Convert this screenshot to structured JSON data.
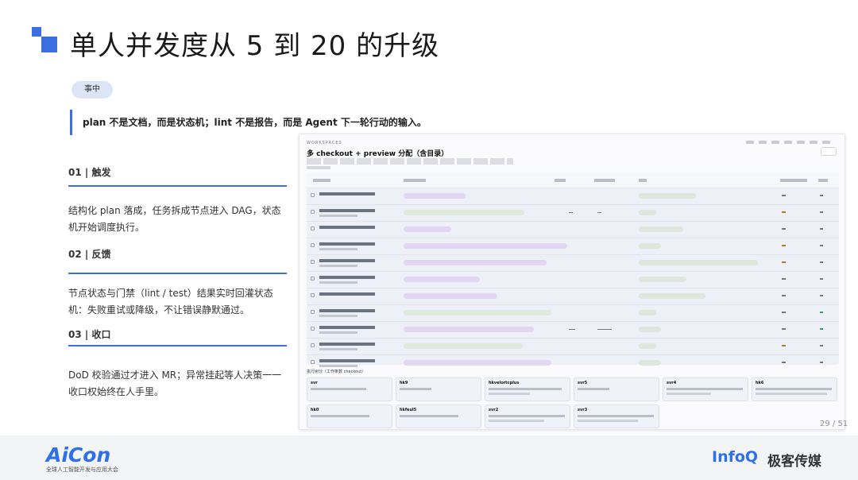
{
  "slide": {
    "title": "单人并发度从 5 到 20 的升级",
    "stage_tag": "事中",
    "quote": "plan 不是文档，而是状态机；lint 不是报告，而是 Agent 下一轮行动的输入。",
    "page_number": "29 / 51"
  },
  "steps": [
    {
      "head": "01 | 触发",
      "body": "结构化 plan 落成，任务拆成节点进入 DAG，状态机开始调度执行。"
    },
    {
      "head": "02 | 反馈",
      "body": "节点状态与门禁（lint / test）结果实时回灌状态机：失败重试或降级，不让错误静默通过。"
    },
    {
      "head": "03 | 收口",
      "body": "DoD 校验通过才进入 MR；异常挂起等人决策一一收口权始终在人手里。"
    }
  ],
  "screenshot": {
    "workspace_label": "WORKSPACES",
    "title": "多 checkout + preview 分配（含目录）",
    "tree_title": "执行树分（工作条数 checkout）",
    "cards": [
      {
        "name": "svr"
      },
      {
        "name": "hk9"
      },
      {
        "name": "hkvelortcplus"
      },
      {
        "name": "svr5"
      },
      {
        "name": "svr4"
      },
      {
        "name": "hk6"
      },
      {
        "name": "hk0"
      },
      {
        "name": "hkfeul5"
      },
      {
        "name": "svr2"
      },
      {
        "name": "svr3"
      }
    ]
  },
  "footer": {
    "aicon_logo": "AiCon",
    "aicon_sub": "全球人工智能开发与应用大会",
    "infoq_main": "InfoQ",
    "geek_logo": "极客传媒"
  }
}
